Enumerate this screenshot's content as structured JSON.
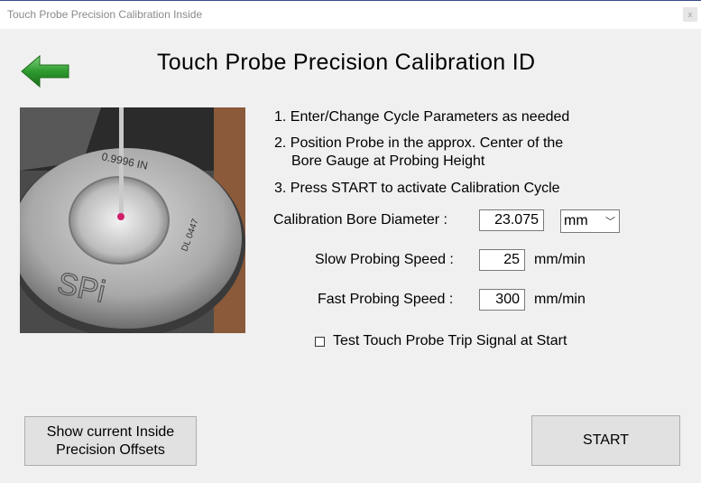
{
  "window": {
    "title": "Touch Probe Precision Calibration Inside",
    "close_glyph": "x"
  },
  "header": {
    "title": "Touch Probe Precision Calibration ID"
  },
  "instructions": {
    "step1": "1. Enter/Change Cycle Parameters as needed",
    "step2_line1": "2. Position Probe in the approx. Center of the",
    "step2_line2": "Bore Gauge at Probing Height",
    "step3": "3. Press START to activate Calibration Cycle"
  },
  "photo": {
    "gauge_text": "0.9996 IN",
    "serial_text": "DL 0447",
    "brand": "SPi"
  },
  "form": {
    "bore_label": "Calibration Bore Diameter :",
    "bore_value": "23.075",
    "unit_selected": "mm",
    "slow_label": "Slow Probing Speed :",
    "slow_value": "25",
    "slow_unit": "mm/min",
    "fast_label": "Fast Probing Speed :",
    "fast_value": "300",
    "fast_unit": "mm/min",
    "test_trip_label": "Test Touch Probe Trip Signal at Start",
    "test_trip_checked": false
  },
  "buttons": {
    "show_offsets_line1": "Show current Inside",
    "show_offsets_line2": "Precision Offsets",
    "start": "START"
  },
  "colors": {
    "arrow_green": "#2e9a2e",
    "button_bg": "#e1e1e1",
    "window_bg": "#f0f0f0"
  }
}
